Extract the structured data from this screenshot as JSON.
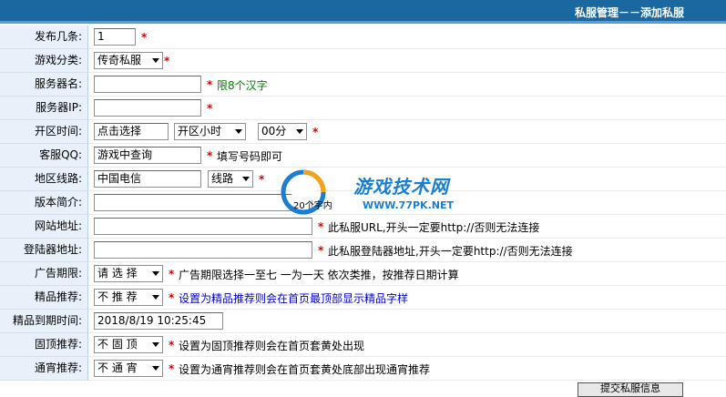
{
  "header": {
    "title": "私服管理－－添加私服"
  },
  "form": {
    "count": {
      "label": "发布几条:",
      "value": "1",
      "star": "*"
    },
    "category": {
      "label": "游戏分类:",
      "value": "传奇私服",
      "star": "*"
    },
    "server_name": {
      "label": "服务器名:",
      "value": "",
      "star": "*",
      "hint": "限8个汉字"
    },
    "server_ip": {
      "label": "服务器IP:",
      "value": "",
      "star": "*"
    },
    "open_time": {
      "label": "开区时间:",
      "value": "点击选择",
      "hour": "开区小时",
      "minute": "00分",
      "star": "*"
    },
    "qq": {
      "label": "客服QQ:",
      "value": "游戏中查询",
      "star": "*",
      "hint": "填写号码即可"
    },
    "region": {
      "label": "地区线路:",
      "value": "中国电信",
      "line": "线路",
      "star": "*"
    },
    "intro": {
      "label": "版本简介:",
      "value": "",
      "hint": "20个字内"
    },
    "website": {
      "label": "网站地址:",
      "value": "",
      "star": "*",
      "hint": "此私服URL,开头一定要http://否则无法连接"
    },
    "launcher": {
      "label": "登陆器地址:",
      "value": "",
      "star": "*",
      "hint": "此私服登陆器地址,开头一定要http://否则无法连接"
    },
    "ad_period": {
      "label": "广告期限:",
      "value": "请 选 择",
      "star": "*",
      "hint": "广告期限选择一至七 一为一天 依次类推，按推荐日期计算"
    },
    "featured": {
      "label": "精品推荐:",
      "value": "不 推 荐",
      "star": "*",
      "hint": "设置为精品推荐则会在首页最顶部显示精品字样"
    },
    "featured_expire": {
      "label": "精品到期时间:",
      "value": "2018/8/19 10:25:45"
    },
    "pin_top": {
      "label": "固顶推荐:",
      "value": "不 固 顶",
      "star": "*",
      "hint": "设置为固顶推荐则会在首页套黄处出现"
    },
    "banner": {
      "label": "通宵推荐:",
      "value": "不 通 宵",
      "star": "*",
      "hint": "设置为通宵推荐则会在首页套黄处底部出现通宵推荐"
    }
  },
  "watermark": {
    "name": "游戏技术网",
    "url": "WWW.77PK.NET"
  },
  "submit": {
    "label": "提交私服信息"
  },
  "colors": {
    "header_bg": "#1b68a0",
    "label_bg": "#e8f1f9",
    "star": "#d00000",
    "hint_green": "#008000",
    "hint_blue": "#0000cc",
    "watermark": "#1a7fd0"
  }
}
